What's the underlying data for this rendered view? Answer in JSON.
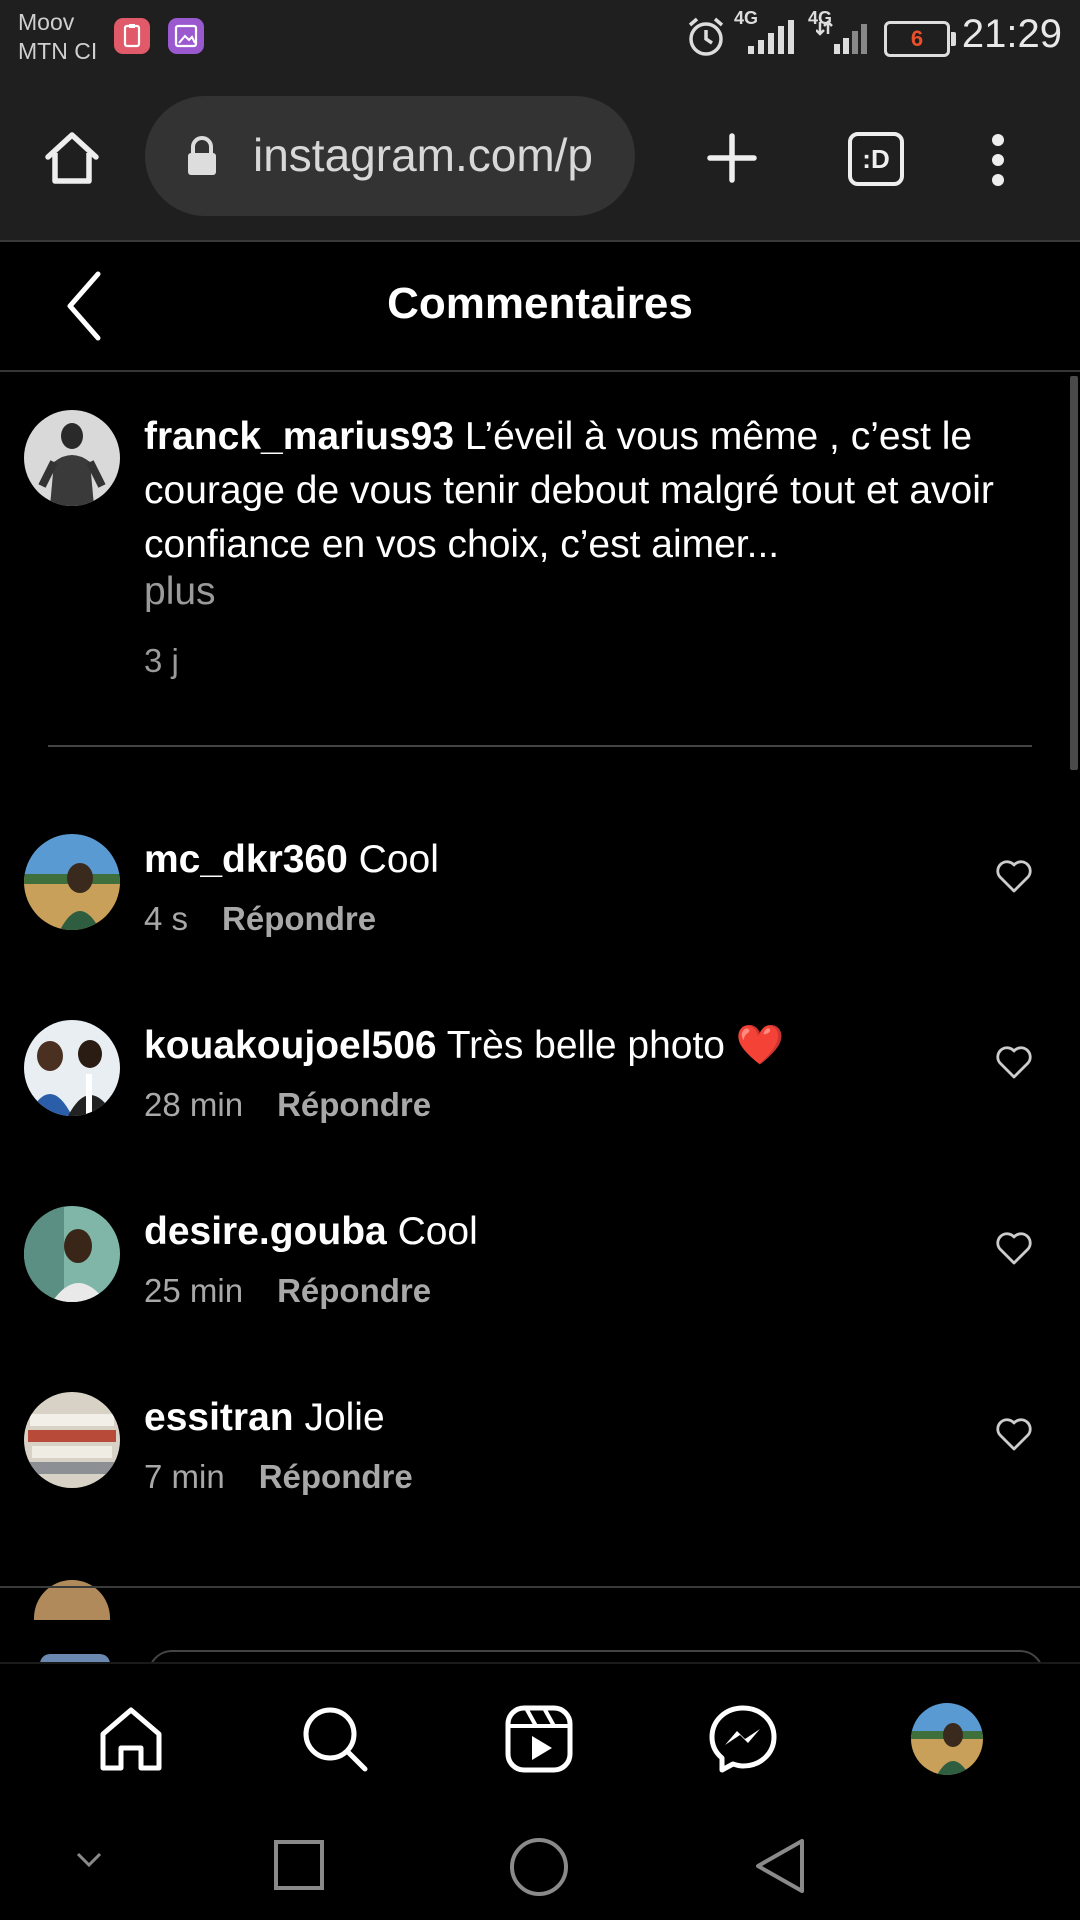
{
  "status_bar": {
    "carrier_line1": "Moov",
    "carrier_line2": "MTN CI",
    "network_1": "4G",
    "network_2": "4G",
    "battery_level": "6",
    "time": "21:29"
  },
  "browser": {
    "url": "instagram.com/p",
    "tab_switcher_label": ":D"
  },
  "header": {
    "title": "Commentaires"
  },
  "caption": {
    "username": "franck_marius93",
    "text": "L’éveil à vous même , c’est le courage de vous tenir debout malgré tout et avoir confiance en vos choix, c’est aimer...",
    "more_label": "plus",
    "time": "3 j"
  },
  "comments": [
    {
      "username": "mc_dkr360",
      "text": "Cool",
      "time": "4 s",
      "reply_label": "Répondre"
    },
    {
      "username": "kouakoujoel506",
      "text": "Très belle photo ❤️",
      "time": "28 min",
      "reply_label": "Répondre"
    },
    {
      "username": "desire.gouba",
      "text": "Cool",
      "time": "25 min",
      "reply_label": "Répondre"
    },
    {
      "username": "essitran",
      "text": "Jolie",
      "time": "7 min",
      "reply_label": "Répondre"
    }
  ],
  "bottom_nav": {
    "items": [
      "home-icon",
      "search-icon",
      "reels-icon",
      "messenger-icon",
      "profile-avatar"
    ]
  },
  "colors": {
    "background": "#000000",
    "browser_bar": "#1f1f1f",
    "muted_text": "#a8a8a8",
    "heart_emoji": "#e8162f"
  }
}
